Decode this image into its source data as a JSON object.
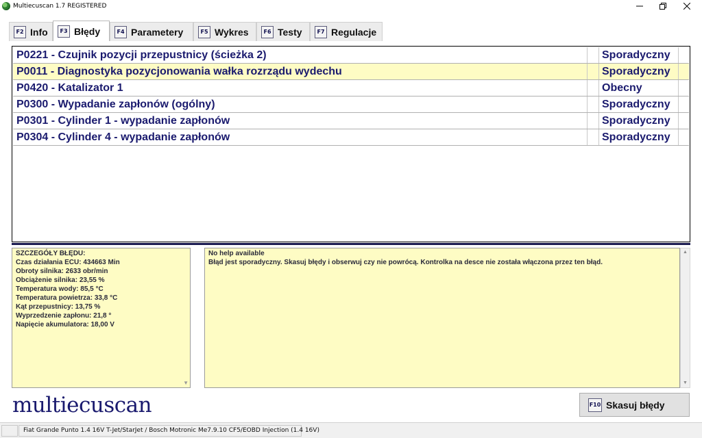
{
  "window": {
    "title": "Multiecuscan 1.7 REGISTERED",
    "minimize_icon": "minimize-icon",
    "maximize_icon": "restore-icon",
    "close_icon": "close-icon"
  },
  "tabs": [
    {
      "key": "F2",
      "label": "Info",
      "active": false
    },
    {
      "key": "F3",
      "label": "Błędy",
      "active": true
    },
    {
      "key": "F4",
      "label": "Parametery",
      "active": false
    },
    {
      "key": "F5",
      "label": "Wykres",
      "active": false
    },
    {
      "key": "F6",
      "label": "Testy",
      "active": false
    },
    {
      "key": "F7",
      "label": "Regulacje",
      "active": false
    }
  ],
  "errors": [
    {
      "code": "P0221 - Czujnik pozycji przepustnicy (ścieżka 2)",
      "status": "Sporadyczny",
      "selected": false
    },
    {
      "code": "P0011 - Diagnostyka pozycjonowania wałka rozrządu wydechu",
      "status": "Sporadyczny",
      "selected": true
    },
    {
      "code": "P0420 - Katalizator 1",
      "status": "Obecny",
      "selected": false
    },
    {
      "code": "P0300 - Wypadanie zapłonów (ogólny)",
      "status": "Sporadyczny",
      "selected": false
    },
    {
      "code": "P0301 - Cylinder 1 - wypadanie zapłonów",
      "status": "Sporadyczny",
      "selected": false
    },
    {
      "code": "P0304 - Cylinder 4 - wypadanie zapłonów",
      "status": "Sporadyczny",
      "selected": false
    }
  ],
  "details": {
    "lines": [
      "SZCZEGÓŁY BŁĘDU:",
      "Czas działania ECU: 434663 Min",
      "Obroty silnika: 2633 obr/min",
      "Obciążenie silnika: 23,55 %",
      "Temperatura wody: 85,5 °C",
      "Temperatura powietrza: 33,8 °C",
      "Kąt przepustnicy: 13,75 %",
      "Wyprzedzenie zapłonu: 21,8 °",
      "Napięcie akumulatora: 18,00 V"
    ]
  },
  "help": {
    "title": "No help available",
    "text": "Błąd jest sporadyczny. Skasuj błędy i obserwuj czy nie powrócą. Kontrolka na desce nie została włączona przez ten błąd."
  },
  "logo": {
    "text": "multiecuscan"
  },
  "actions": {
    "clear_key": "F10",
    "clear_label": "Skasuj błędy"
  },
  "status_bar": {
    "vehicle": "Fiat Grande Punto 1.4 16V T-Jet/StarJet / Bosch Motronic Me7.9.10 CF5/EOBD Injection (1.4 16V)"
  },
  "colors": {
    "selected_row": "#fefcc4",
    "panel_bg": "#fefcc4",
    "text_dark_blue": "#1a1a6e"
  }
}
